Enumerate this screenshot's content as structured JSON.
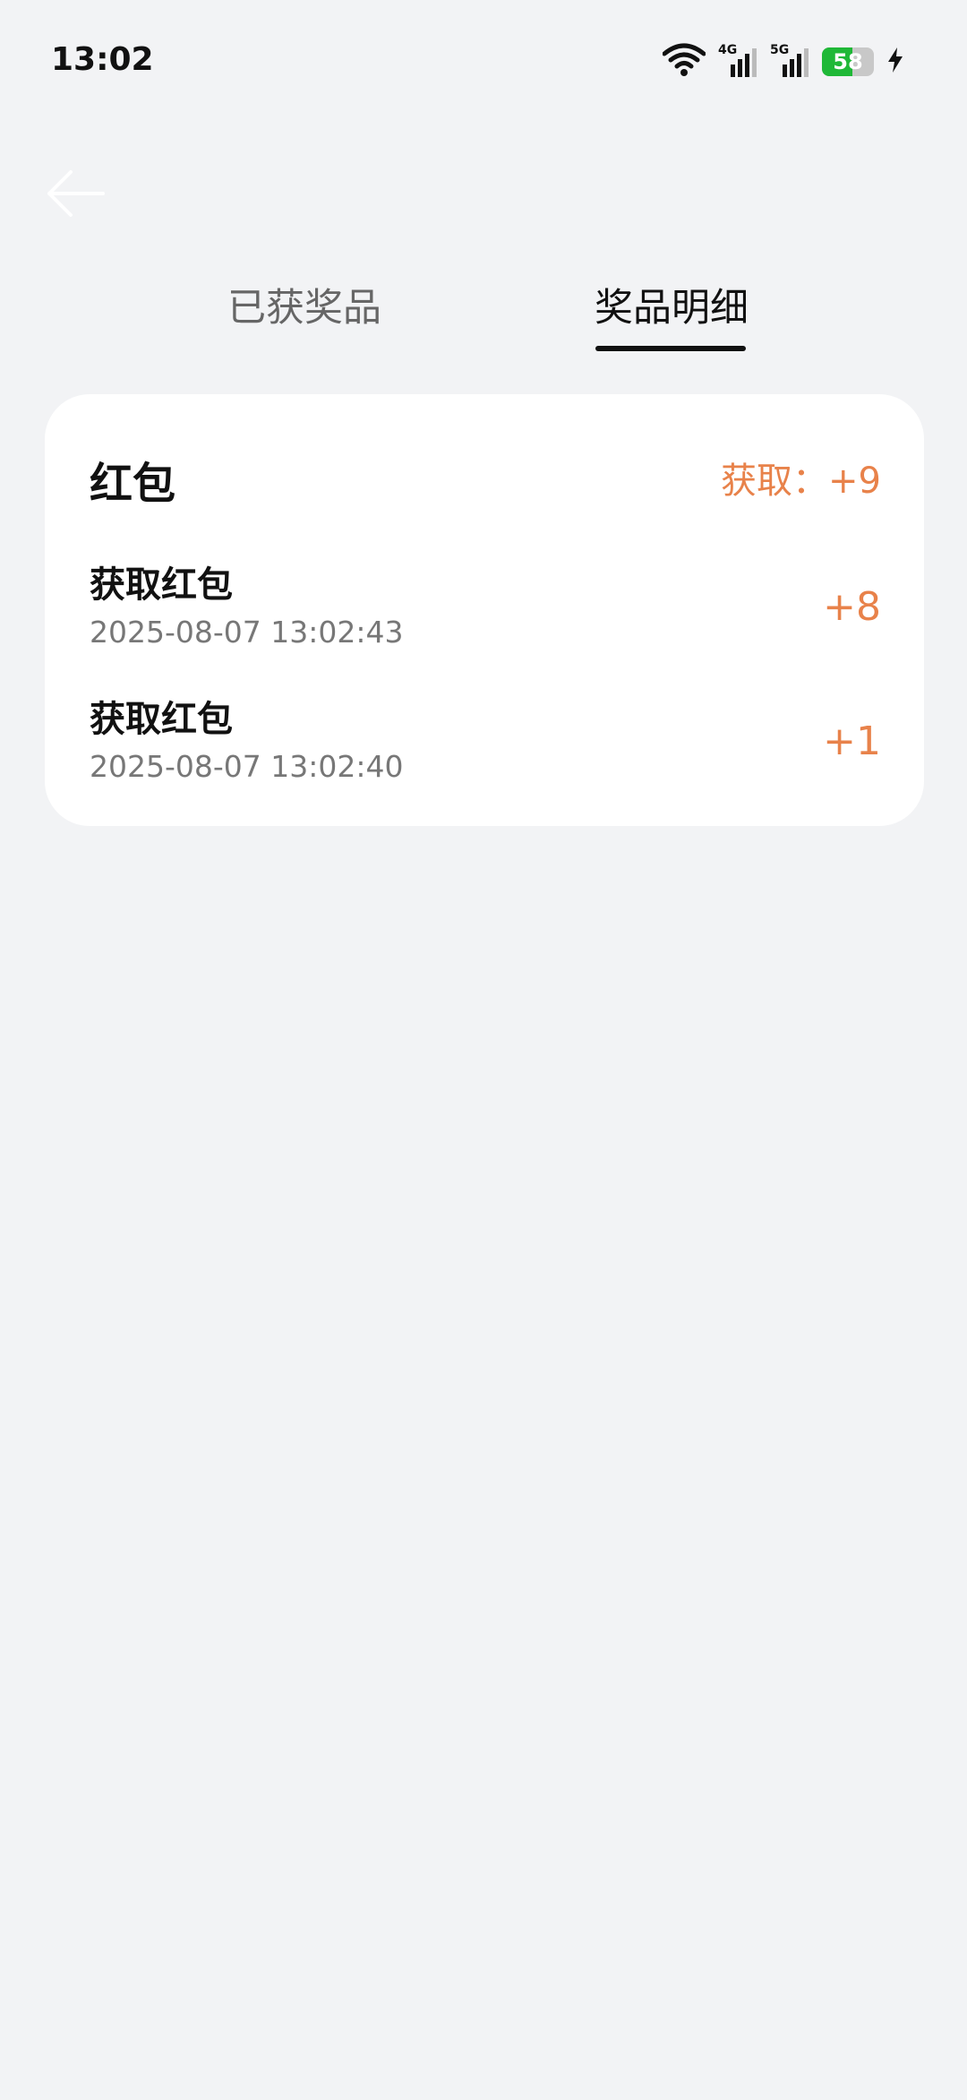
{
  "status": {
    "time": "13:02",
    "network_4g": "4G",
    "network_5g": "5G",
    "battery_level": "58"
  },
  "tabs": [
    {
      "label": "已获奖品",
      "active": false
    },
    {
      "label": "奖品明细",
      "active": true
    }
  ],
  "card": {
    "title": "红包",
    "total_label": "获取：",
    "total_value": "+9",
    "records": [
      {
        "title": "获取红包",
        "time": "2025-08-07 13:02:43",
        "amount": "+8"
      },
      {
        "title": "获取红包",
        "time": "2025-08-07 13:02:40",
        "amount": "+1"
      }
    ]
  },
  "colors": {
    "accent": "#e8824a",
    "background": "#f2f3f5",
    "battery_green": "#1fb837"
  }
}
